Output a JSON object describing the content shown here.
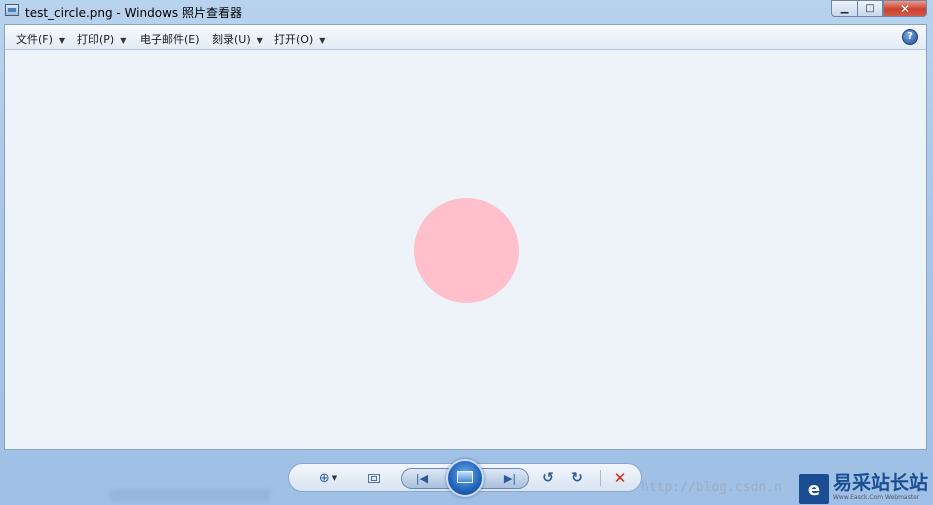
{
  "window": {
    "title": "test_circle.png - Windows 照片查看器",
    "minimize_symbol": "▁",
    "maximize_symbol": "□",
    "close_symbol": "✕"
  },
  "menu": {
    "items": [
      {
        "label": "文件(F)",
        "has_dropdown": true
      },
      {
        "label": "打印(P)",
        "has_dropdown": true
      },
      {
        "label": "电子邮件(E)",
        "has_dropdown": false
      },
      {
        "label": "刻录(U)",
        "has_dropdown": true
      },
      {
        "label": "打开(O)",
        "has_dropdown": true
      }
    ],
    "dropdown_arrow": "▼",
    "help_symbol": "?"
  },
  "image": {
    "shape": "circle",
    "fill_color": "#ffbfcb"
  },
  "controls": {
    "zoom_symbol": "⊕",
    "zoom_dropdown": "▼",
    "prev_symbol": "|◀",
    "next_symbol": "▶|",
    "rotate_left_symbol": "↺",
    "rotate_right_symbol": "↻",
    "delete_symbol": "✕"
  },
  "watermark": {
    "url_text": "http://blog.csdn.n",
    "badge_logo_text": "e",
    "badge_name": "易采站长站",
    "badge_subtitle": "Www.Easck.Com Webmaster"
  }
}
